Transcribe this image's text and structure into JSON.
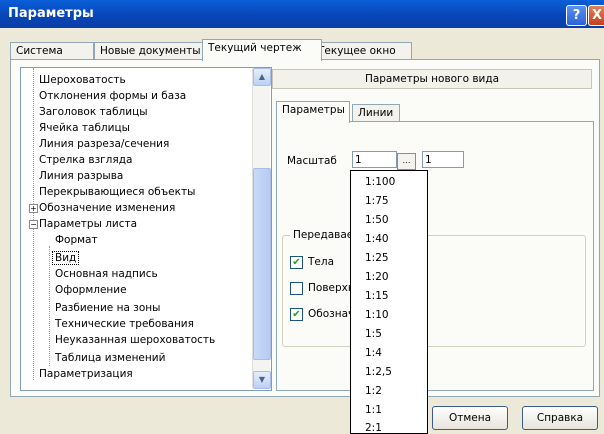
{
  "window": {
    "title": "Параметры",
    "help_glyph": "?",
    "close_glyph": "X"
  },
  "main_tabs": [
    {
      "label": "Система"
    },
    {
      "label": "Новые документы"
    },
    {
      "label": "Текущий чертеж"
    },
    {
      "label": "Текущее окно"
    }
  ],
  "tree": {
    "items": [
      {
        "label": "Шероховатость"
      },
      {
        "label": "Отклонения формы и база"
      },
      {
        "label": "Заголовок таблицы"
      },
      {
        "label": "Ячейка таблицы"
      },
      {
        "label": "Линия разреза/сечения"
      },
      {
        "label": "Стрелка взгляда"
      },
      {
        "label": "Линия разрыва"
      },
      {
        "label": "Перекрывающиеся объекты"
      },
      {
        "label": "Обозначение изменения"
      },
      {
        "label": "Параметры листа"
      },
      {
        "label": "Формат"
      },
      {
        "label": "Вид"
      },
      {
        "label": "Основная надпись"
      },
      {
        "label": "Оформление"
      },
      {
        "label": "Разбиение на зоны"
      },
      {
        "label": "Технические требования"
      },
      {
        "label": "Неуказанная шероховатость"
      },
      {
        "label": "Таблица изменений"
      },
      {
        "label": "Параметризация"
      }
    ],
    "expand_plus": "+",
    "expand_minus": "−"
  },
  "right": {
    "header": "Параметры нового вида",
    "sub_tabs": [
      {
        "label": "Параметры"
      },
      {
        "label": "Линии"
      }
    ],
    "scale_label": "Масштаб",
    "scale_value_1": "1",
    "scale_value_2": "1",
    "group_label": "Передавае",
    "checkboxes": [
      {
        "label": "Тела",
        "checked": true
      },
      {
        "label": "Поверхн",
        "checked": false
      },
      {
        "label": "Обозначе",
        "checked": true
      }
    ]
  },
  "scale_options": [
    "1:100",
    "1:75",
    "1:50",
    "1:40",
    "1:25",
    "1:20",
    "1:15",
    "1:10",
    "1:5",
    "1:4",
    "1:2,5",
    "1:2",
    "1:1",
    "2:1"
  ],
  "footer": {
    "cancel": "Отмена",
    "help": "Справка"
  },
  "icons": {
    "scroll_up": "▲",
    "scroll_down": "▼",
    "dropdown": "…",
    "check": "✔"
  },
  "colors": {
    "title_bar": "#0a4fc8",
    "dialog_bg": "#ece9d8",
    "check": "#21a121"
  }
}
